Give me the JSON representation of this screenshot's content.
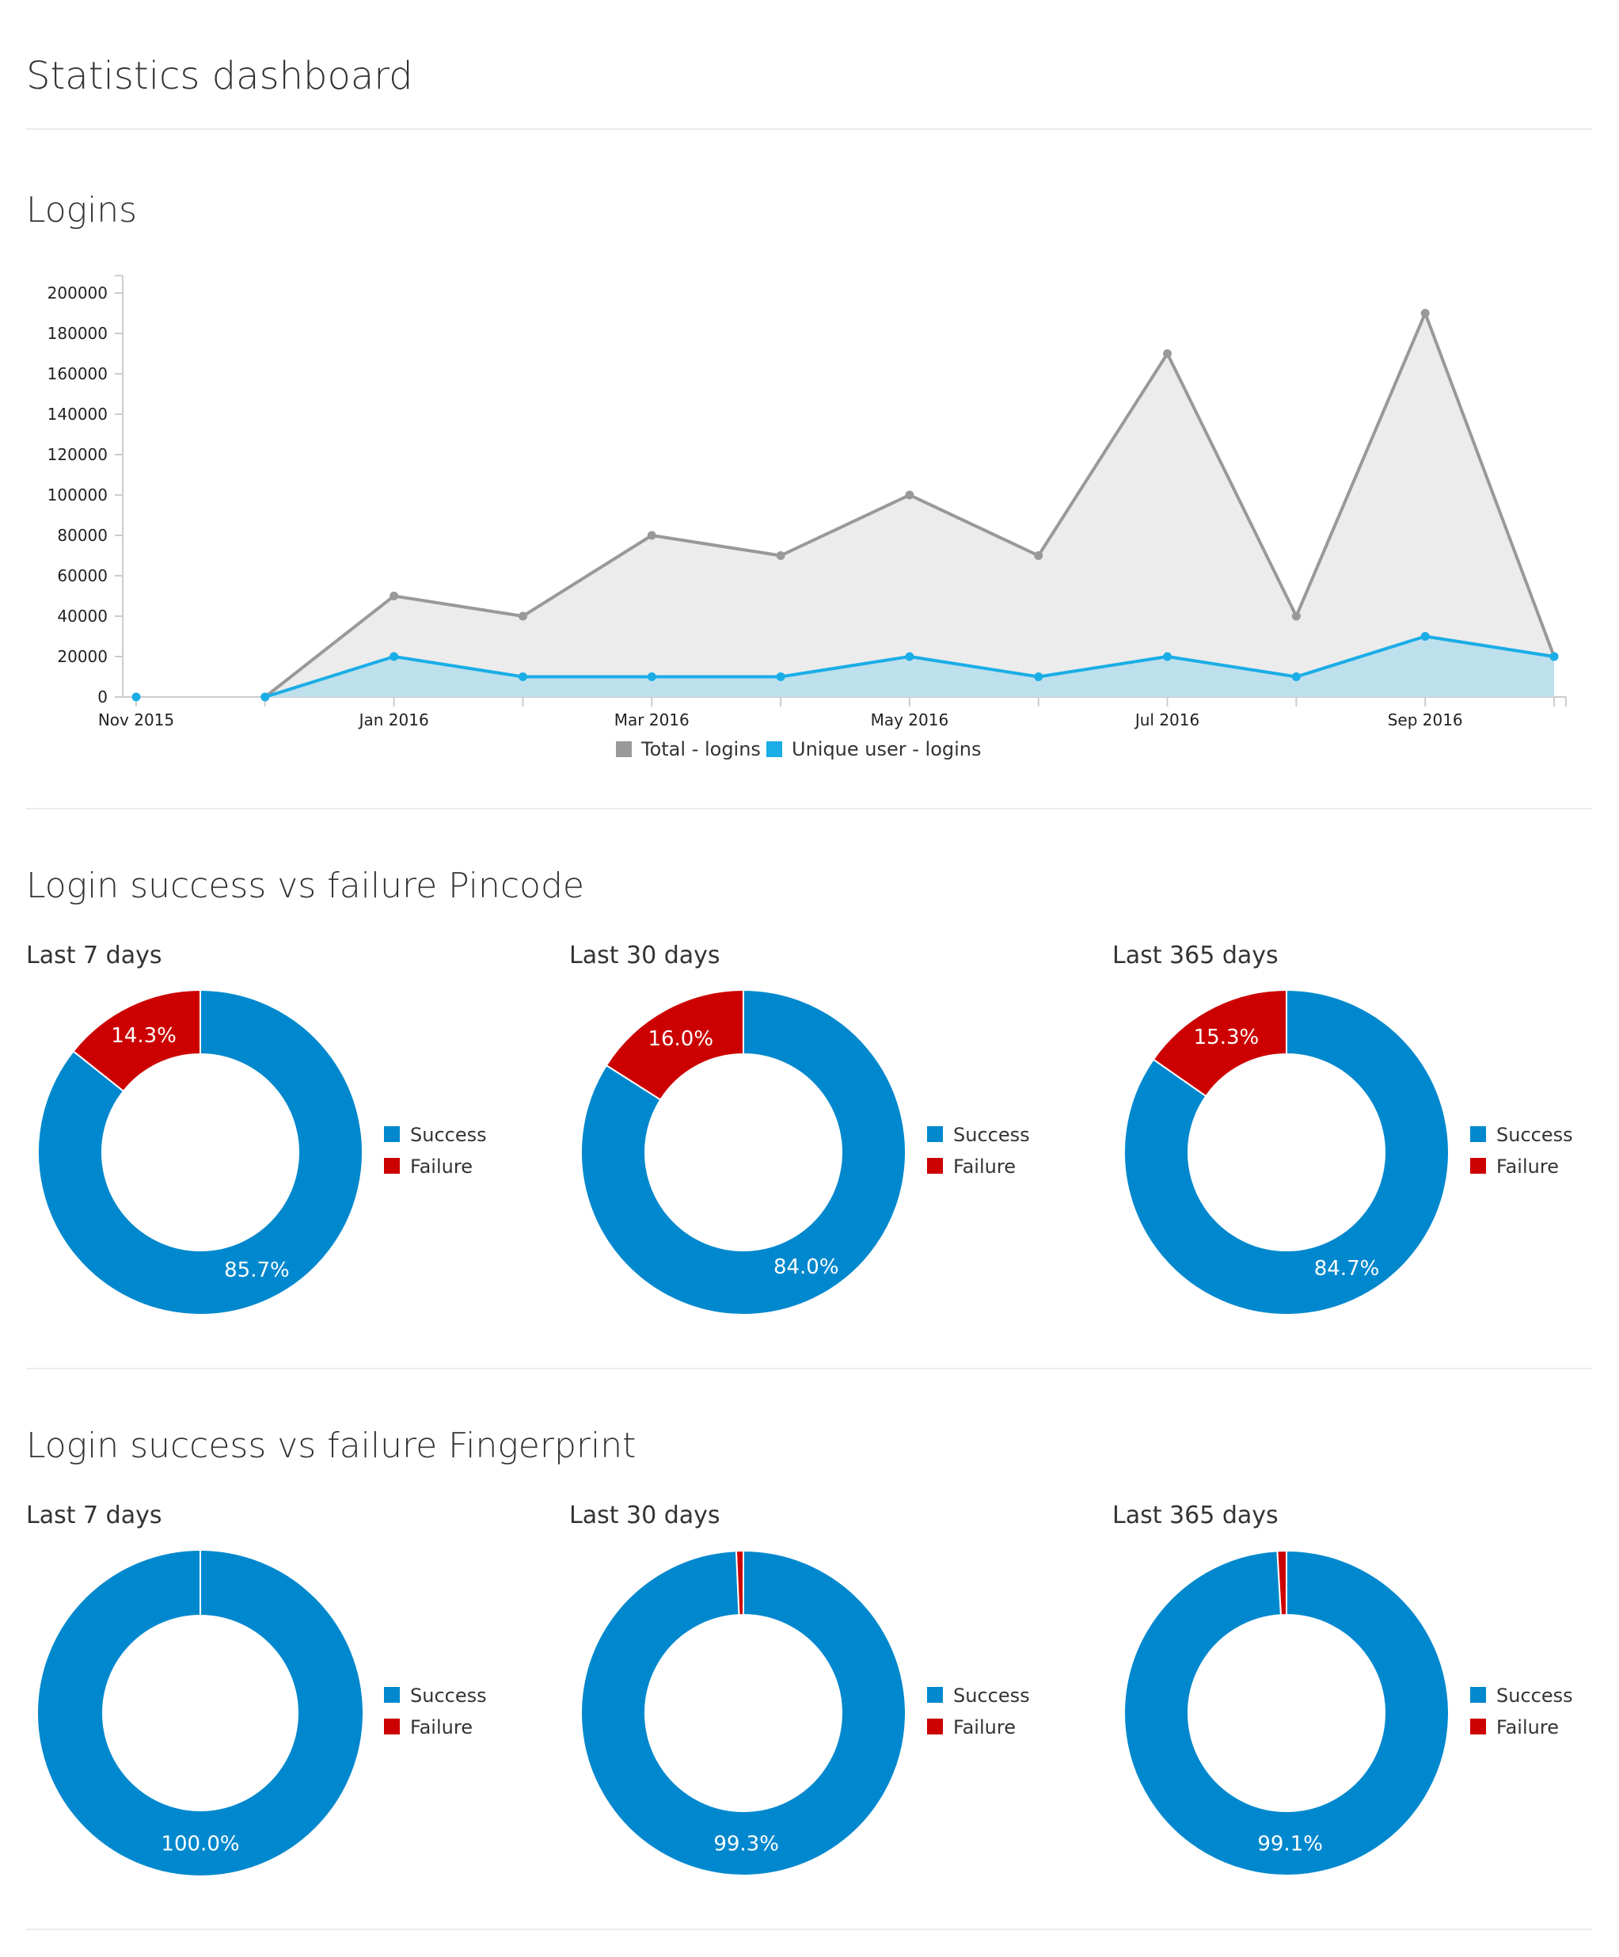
{
  "page": {
    "title": "Statistics dashboard"
  },
  "logins_section": {
    "title": "Logins"
  },
  "colors": {
    "total_line": "#999999",
    "total_fill": "#ececec",
    "unique_line": "#1aade6",
    "unique_fill": "#bde0ec",
    "success": "#0088ce",
    "failure": "#cc0000",
    "axis": "#cccccc"
  },
  "chart_data": [
    {
      "type": "area",
      "title": "Logins",
      "x": [
        "2015-11",
        "2015-12",
        "2016-01",
        "2016-02",
        "2016-03",
        "2016-04",
        "2016-05",
        "2016-06",
        "2016-07",
        "2016-08",
        "2016-09",
        "2016-10"
      ],
      "x_tick_labels": [
        "Nov 2015",
        "Jan 2016",
        "Mar 2016",
        "May 2016",
        "Jul 2016",
        "Sep 2016"
      ],
      "series": [
        {
          "name": "Total - logins",
          "values": [
            0,
            0,
            50000,
            40000,
            80000,
            70000,
            100000,
            70000,
            170000,
            40000,
            190000,
            20000
          ]
        },
        {
          "name": "Unique user - logins",
          "values": [
            0,
            0,
            20000,
            10000,
            10000,
            10000,
            20000,
            10000,
            20000,
            10000,
            30000,
            20000
          ]
        }
      ],
      "y_ticks": [
        0,
        20000,
        40000,
        60000,
        80000,
        100000,
        120000,
        140000,
        160000,
        180000,
        200000
      ],
      "ylim": [
        0,
        200000
      ],
      "grid": false,
      "legend": "bottom"
    },
    {
      "type": "pie",
      "group": "Login success vs failure Pincode",
      "title": "Last 7 days",
      "labels": [
        "Success",
        "Failure"
      ],
      "values": [
        85.7,
        14.3
      ],
      "value_labels": [
        "85.7%",
        "14.3%"
      ],
      "legend": "right"
    },
    {
      "type": "pie",
      "group": "Login success vs failure Pincode",
      "title": "Last 30 days",
      "labels": [
        "Success",
        "Failure"
      ],
      "values": [
        84.0,
        16.0
      ],
      "value_labels": [
        "84.0%",
        "16.0%"
      ],
      "legend": "right"
    },
    {
      "type": "pie",
      "group": "Login success vs failure Pincode",
      "title": "Last 365 days",
      "labels": [
        "Success",
        "Failure"
      ],
      "values": [
        84.7,
        15.3
      ],
      "value_labels": [
        "84.7%",
        "15.3%"
      ],
      "legend": "right"
    },
    {
      "type": "pie",
      "group": "Login success vs failure Fingerprint",
      "title": "Last 7 days",
      "labels": [
        "Success",
        "Failure"
      ],
      "values": [
        100.0,
        0.0
      ],
      "value_labels": [
        "100.0%",
        ""
      ],
      "legend": "right"
    },
    {
      "type": "pie",
      "group": "Login success vs failure Fingerprint",
      "title": "Last 30 days",
      "labels": [
        "Success",
        "Failure"
      ],
      "values": [
        99.3,
        0.7
      ],
      "value_labels": [
        "99.3%",
        ""
      ],
      "legend": "right"
    },
    {
      "type": "pie",
      "group": "Login success vs failure Fingerprint",
      "title": "Last 365 days",
      "labels": [
        "Success",
        "Failure"
      ],
      "values": [
        99.1,
        0.9
      ],
      "value_labels": [
        "99.1%",
        ""
      ],
      "legend": "right"
    }
  ],
  "pincode_section": {
    "title": "Login success vs failure Pincode",
    "periods": [
      "Last 7 days",
      "Last 30 days",
      "Last 365 days"
    ]
  },
  "fingerprint_section": {
    "title": "Login success vs failure Fingerprint",
    "periods": [
      "Last 7 days",
      "Last 30 days",
      "Last 365 days"
    ]
  }
}
